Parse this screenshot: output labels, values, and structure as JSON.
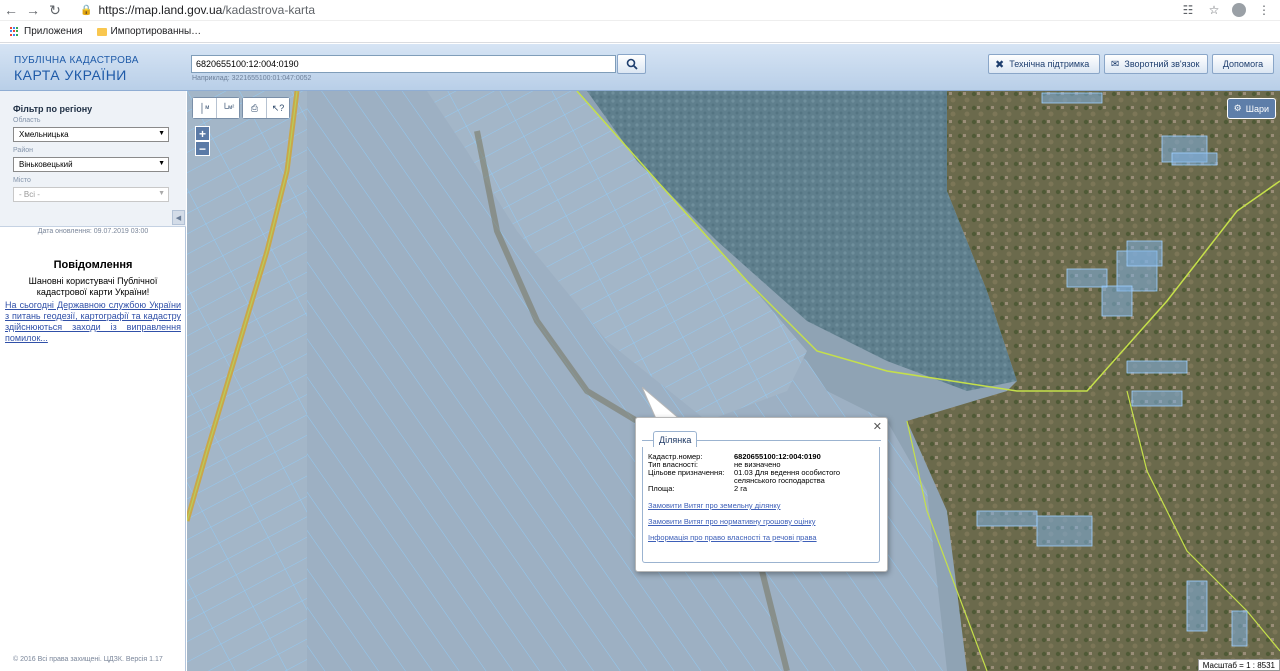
{
  "browser": {
    "url_host": "https://map.land.gov.ua",
    "url_path": "/kadastrova-karta",
    "bookmarks": [
      "Приложения",
      "Импортированны…"
    ]
  },
  "header": {
    "brand_line1": "ПУБЛІЧНА КАДАСТРОВА",
    "brand_line2": "КАРТА УКРАЇНИ",
    "search_value": "6820655100:12:004:0190",
    "search_hint": "Наприклад: 3221655100:01:047:0052",
    "buttons": {
      "support": "Технічна підтримка",
      "feedback": "Зворотний зв'язок",
      "help": "Допомога"
    }
  },
  "sidebar": {
    "filter_title": "Фільтр по регіону",
    "oblast_label": "Область",
    "oblast_value": "Хмельницька",
    "rayon_label": "Район",
    "rayon_value": "Віньковецький",
    "misto_label": "Місто",
    "misto_value": "- Всі -",
    "update_date": "Дата оновлення: 09.07.2019 03:00",
    "notice_title": "Повідомлення",
    "notice_sub": "Шановні користувачі Публічної кадастрової карти України!",
    "notice_link": "На сьогодні Державною службою України з питань геодезії, картографії та кадастру здійснюються заходи із виправлення помилок...",
    "copyright": "© 2016 Всі права захищені. ЦДЗК. Версія 1.17"
  },
  "map": {
    "layers_label": "Шари",
    "scale_text": "Масштаб = 1 : 8531",
    "popup": {
      "tab": "Ділянка",
      "cadastral_label": "Кадастр.номер:",
      "cadastral_value": "6820655100:12:004:0190",
      "ownership_label": "Тип власності:",
      "ownership_value": "не визначено",
      "purpose_label": "Цільове призначення:",
      "purpose_value": "01.03 Для ведення особистого селянського господарства",
      "area_label": "Площа:",
      "area_value": "2 га",
      "link1": "Замовити Витяг про земельну ділянку",
      "link2": "Замовити Витяг про нормативну грошову оцінку",
      "link3": "Інформація про право власності та речові права"
    }
  }
}
